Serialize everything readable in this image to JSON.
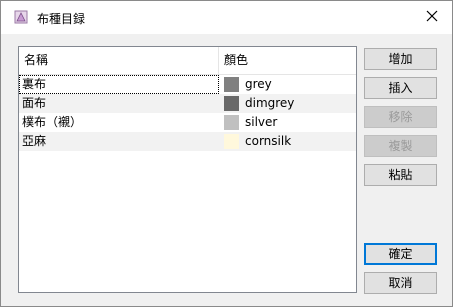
{
  "window": {
    "title": "布種目録",
    "app_icon": "app-icon",
    "close_icon": "close-icon"
  },
  "list": {
    "columns": [
      "名稱",
      "顏色"
    ],
    "rows": [
      {
        "name": "裏布",
        "color_name": "grey",
        "color": "#808080"
      },
      {
        "name": "面布",
        "color_name": "dimgrey",
        "color": "#696969"
      },
      {
        "name": "樸布（襯）",
        "color_name": "silver",
        "color": "#c0c0c0"
      },
      {
        "name": "亞麻",
        "color_name": "cornsilk",
        "color": "#fff8dc"
      }
    ]
  },
  "buttons": {
    "add": "增加",
    "insert": "插入",
    "remove": "移除",
    "copy": "複製",
    "paste": "粘貼",
    "ok": "確定",
    "cancel": "取消"
  }
}
